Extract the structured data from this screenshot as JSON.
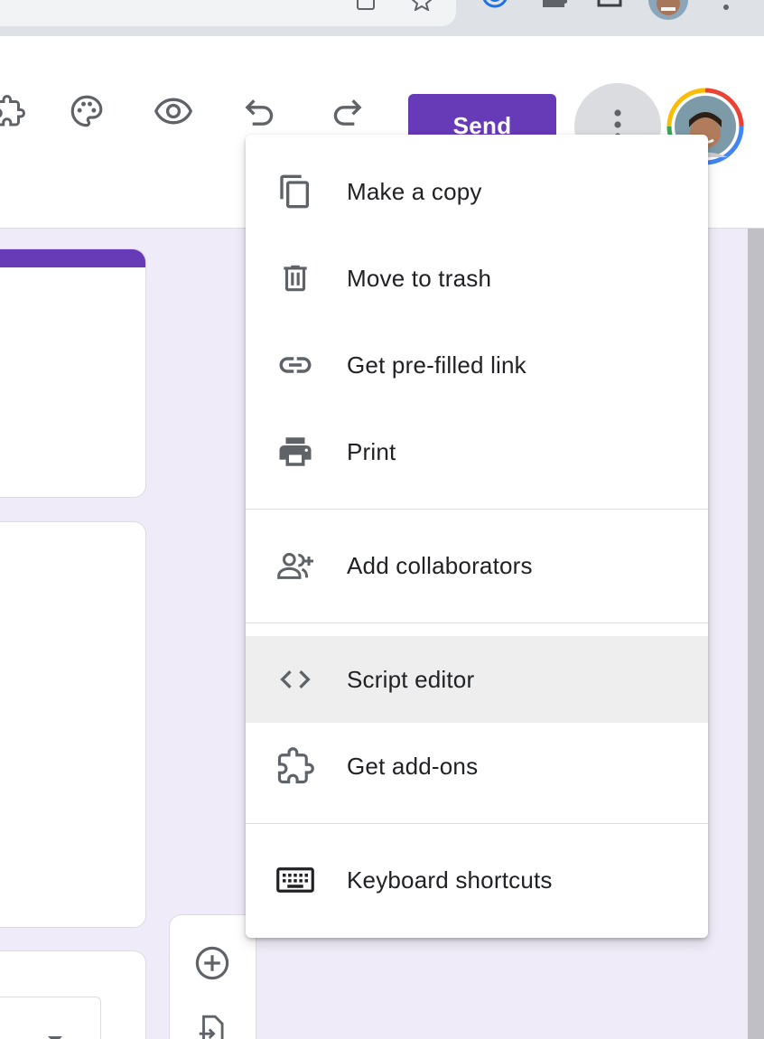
{
  "toolbar": {
    "send_label": "Send",
    "icons": [
      "addon-icon",
      "palette-icon",
      "preview-eye-icon",
      "undo-icon",
      "redo-icon",
      "more-vert-icon"
    ]
  },
  "menu": {
    "items": [
      {
        "label": "Make a copy",
        "icon": "copy-icon"
      },
      {
        "label": "Move to trash",
        "icon": "trash-icon"
      },
      {
        "label": "Get pre-filled link",
        "icon": "link-icon"
      },
      {
        "label": "Print",
        "icon": "print-icon"
      },
      {
        "label": "Add collaborators",
        "icon": "add-collaborators-icon"
      },
      {
        "label": "Script editor",
        "icon": "code-icon",
        "highlighted": true
      },
      {
        "label": "Get add-ons",
        "icon": "puzzle-icon"
      },
      {
        "label": "Keyboard shortcuts",
        "icon": "keyboard-icon"
      }
    ]
  },
  "colors": {
    "accent": "#673ab7",
    "page_background": "#f0ebf8",
    "menu_highlight": "#eeeeee",
    "icon_gray": "#5f6368"
  }
}
